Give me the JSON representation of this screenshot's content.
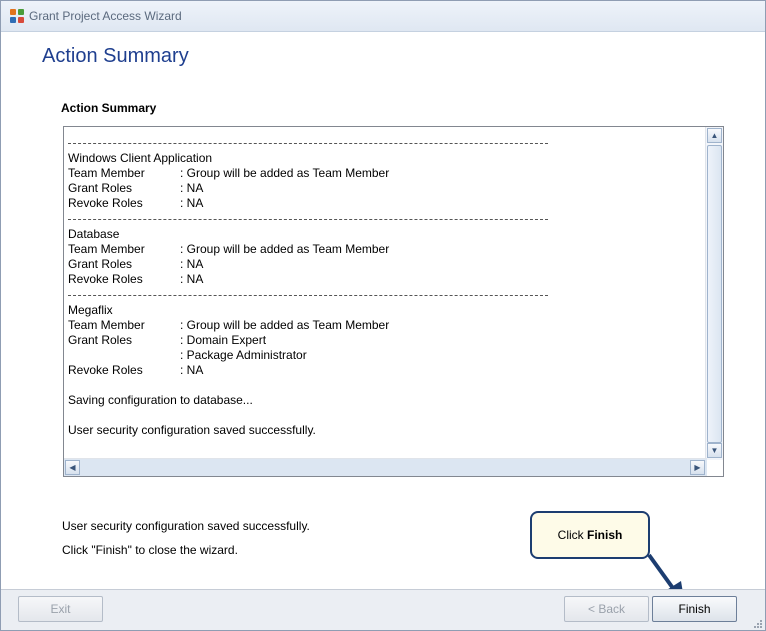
{
  "window": {
    "title": "Grant Project Access Wizard"
  },
  "header": {
    "title": "Action Summary"
  },
  "summary": {
    "section_label": "Action Summary",
    "blocks": [
      {
        "name": "Windows Client Application",
        "rows": [
          {
            "label": "Team Member",
            "value": ": Group will be added as Team Member"
          },
          {
            "label": "Grant Roles",
            "value": ": NA"
          },
          {
            "label": "Revoke Roles",
            "value": ": NA"
          }
        ]
      },
      {
        "name": "Database",
        "rows": [
          {
            "label": "Team Member",
            "value": ": Group will be added as Team Member"
          },
          {
            "label": "Grant Roles",
            "value": ": NA"
          },
          {
            "label": "Revoke Roles",
            "value": ": NA"
          }
        ]
      },
      {
        "name": "Megaflix",
        "rows": [
          {
            "label": "Team Member",
            "value": ": Group will be added as Team Member"
          },
          {
            "label": "Grant Roles",
            "value": ": Domain Expert"
          },
          {
            "label": "",
            "value": ": Package Administrator"
          },
          {
            "label": "Revoke Roles",
            "value": ": NA"
          }
        ]
      }
    ],
    "saving_msg": "Saving configuration to database...",
    "saved_msg": "User security configuration saved successfully."
  },
  "status": {
    "line1": "User security configuration saved successfully.",
    "line2": "Click \"Finish\" to close the wizard."
  },
  "callout": {
    "prefix": "Click ",
    "bold": "Finish"
  },
  "footer": {
    "exit_label": "Exit",
    "back_label": "< Back",
    "finish_label": "Finish"
  },
  "colors": {
    "header": "#1f3f8f",
    "callout_border": "#1c3d70",
    "callout_bg": "#fefbe8"
  }
}
